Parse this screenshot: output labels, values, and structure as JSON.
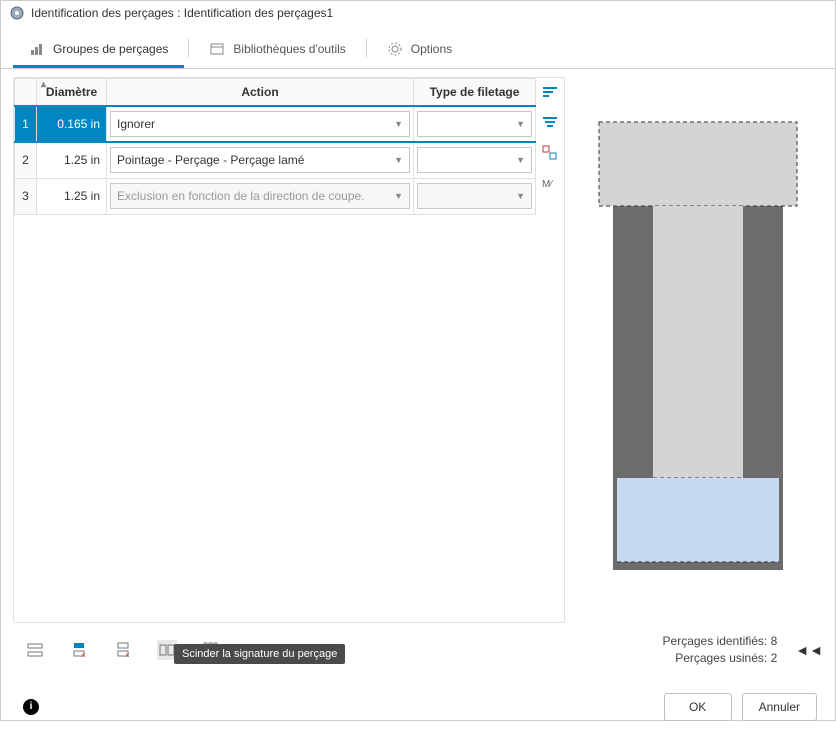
{
  "window": {
    "title": "Identification des perçages : Identification des perçages1"
  },
  "tabs": {
    "groups": "Groupes de perçages",
    "libs": "Bibliothèques d'outils",
    "options": "Options"
  },
  "table": {
    "headers": {
      "diameter": "Diamètre",
      "action": "Action",
      "thread": "Type de filetage"
    },
    "rows": [
      {
        "num": "1",
        "diameter": "0.165 in",
        "action": "Ignorer",
        "thread": "",
        "selected": true,
        "disabled": false
      },
      {
        "num": "2",
        "diameter": "1.25 in",
        "action": "Pointage - Perçage - Perçage lamé",
        "thread": "",
        "selected": false,
        "disabled": false
      },
      {
        "num": "3",
        "diameter": "1.25 in",
        "action": "Exclusion en fonction de la direction de coupe.",
        "thread": "",
        "selected": false,
        "disabled": true
      }
    ]
  },
  "stats": {
    "identified_label": "Perçages identifiés:",
    "identified_count": "8",
    "machined_label": "Perçages usinés:",
    "machined_count": "2"
  },
  "tooltip": "Scinder la signature du perçage",
  "buttons": {
    "ok": "OK",
    "cancel": "Annuler"
  }
}
